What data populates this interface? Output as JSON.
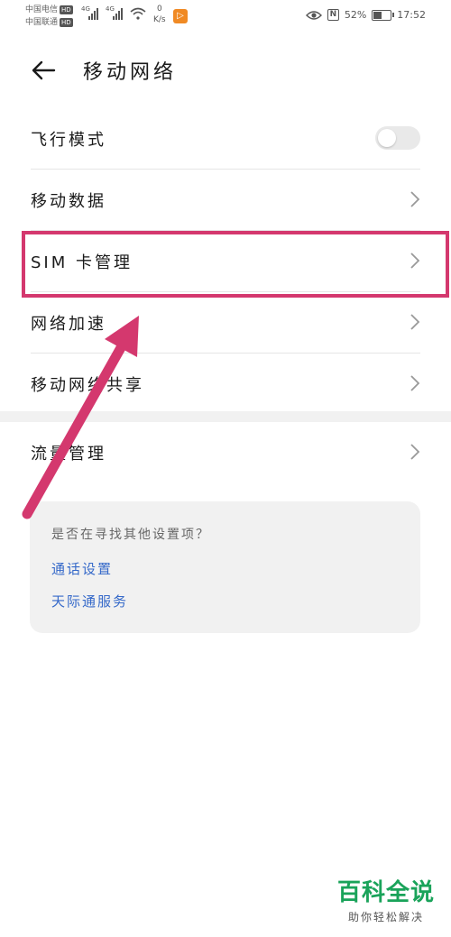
{
  "status_bar": {
    "carrier1": "中国电信",
    "carrier2": "中国联通",
    "hd_badge": "HD",
    "net_type": "4G",
    "net_speed_value": "0",
    "net_speed_unit": "K/s",
    "battery_percent": "52%",
    "battery_level": 0.52,
    "time": "17:52"
  },
  "header": {
    "title": "移动网络"
  },
  "list": {
    "items": [
      {
        "label": "飞行模式",
        "control": "toggle",
        "toggle_on": false
      },
      {
        "label": "移动数据",
        "control": "chevron"
      },
      {
        "label": "SIM 卡管理",
        "control": "chevron"
      },
      {
        "label": "网络加速",
        "control": "chevron"
      },
      {
        "label": "移动网络共享",
        "control": "chevron"
      }
    ]
  },
  "list2": {
    "items": [
      {
        "label": "流量管理",
        "control": "chevron"
      }
    ]
  },
  "suggestion_card": {
    "question": "是否在寻找其他设置项？",
    "links": [
      "通话设置",
      "天际通服务"
    ]
  },
  "watermark": {
    "brand": "百科全说",
    "slogan": "助你轻松解决"
  },
  "colors": {
    "highlight": "#d4386e",
    "link": "#3569c9",
    "watermark_green": "#1aa35a"
  }
}
